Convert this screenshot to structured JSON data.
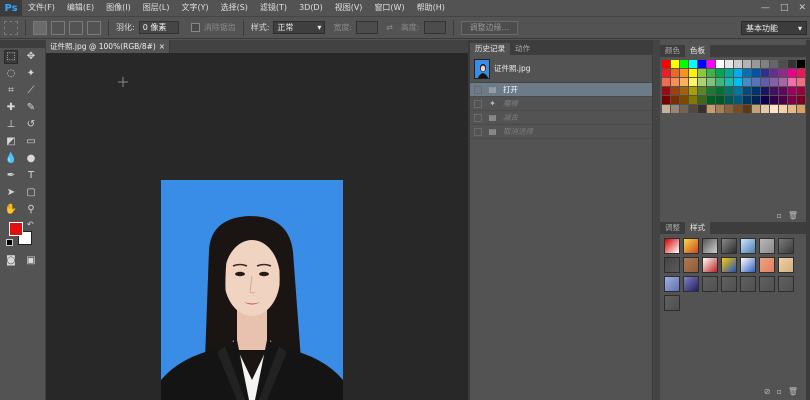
{
  "app": {
    "logo": "Ps"
  },
  "menubar": {
    "items": [
      "文件(F)",
      "编辑(E)",
      "图像(I)",
      "图层(L)",
      "文字(Y)",
      "选择(S)",
      "滤镜(T)",
      "3D(D)",
      "视图(V)",
      "窗口(W)",
      "帮助(H)"
    ],
    "window_controls": [
      "—",
      "□",
      "✕"
    ]
  },
  "options": {
    "feather_label": "羽化:",
    "feather_value": "0 像素",
    "antialias_label": "消除锯齿",
    "style_label": "样式:",
    "style_value": "正常",
    "width_label": "宽度:",
    "height_label": "高度:",
    "refine_edge": "调整边缘...",
    "workspace": "基本功能"
  },
  "document": {
    "tab_title": "证件照.jpg @ 100%(RGB/8#)",
    "tab_close": "×"
  },
  "history": {
    "tabs": [
      "历史记录",
      "动作"
    ],
    "snapshot_name": "证件照.jpg",
    "steps": [
      {
        "label": "打开",
        "state": "active"
      },
      {
        "label": "魔棒",
        "state": "dim"
      },
      {
        "label": "减去",
        "state": "dim"
      },
      {
        "label": "取消选择",
        "state": "dim"
      }
    ]
  },
  "swatches": {
    "tabs": [
      "颜色",
      "色板"
    ],
    "colors": [
      "#ff0000",
      "#ffff00",
      "#00ff00",
      "#00ffff",
      "#0000ff",
      "#ff00ff",
      "#ffffff",
      "#e6e6e6",
      "#cccccc",
      "#b3b3b3",
      "#999999",
      "#808080",
      "#666666",
      "#4d4d4d",
      "#333333",
      "#000000",
      "#ee1c24",
      "#f26522",
      "#f7941d",
      "#fff200",
      "#8dc63f",
      "#39b54a",
      "#00a651",
      "#00a99d",
      "#00aeef",
      "#0072bc",
      "#0054a6",
      "#2e3192",
      "#662d91",
      "#92278f",
      "#ec008c",
      "#ed145b",
      "#f26c4f",
      "#f68e56",
      "#fbaf5d",
      "#fff568",
      "#acd373",
      "#7cc576",
      "#3bb878",
      "#1abbb4",
      "#00bff3",
      "#438ccb",
      "#5574b9",
      "#605ca8",
      "#8560a8",
      "#a864a8",
      "#f06eaa",
      "#f26d7d",
      "#9e0b0f",
      "#a0410d",
      "#a36209",
      "#aba000",
      "#598527",
      "#1a7b30",
      "#007236",
      "#00746b",
      "#0076a3",
      "#004b80",
      "#003471",
      "#1b1464",
      "#440e62",
      "#630460",
      "#9e005d",
      "#9e0039",
      "#790000",
      "#7b2e00",
      "#7d4900",
      "#827b00",
      "#406618",
      "#005e20",
      "#005826",
      "#005952",
      "#005b7f",
      "#003663",
      "#002157",
      "#0d004c",
      "#32004b",
      "#4b0049",
      "#7b0046",
      "#7a0026",
      "#c7b299",
      "#998675",
      "#736357",
      "#534741",
      "#37302a",
      "#c69c6d",
      "#a67c52",
      "#8c6239",
      "#754c24",
      "#603913",
      "#c2a378",
      "#e6c9a8",
      "#ffe4c7",
      "#f5d0a9",
      "#e8b88a",
      "#d9a066"
    ]
  },
  "styles": {
    "tabs": [
      "调整",
      "样式"
    ],
    "items": [
      {
        "bg": "#ffffff",
        "fg": "#d40000",
        "icon": "none-style-icon"
      },
      {
        "bg": "#c84a1e",
        "fg": "#ffd54a",
        "icon": "star-style-icon"
      },
      {
        "bg": "#cfcfcf",
        "fg": "#555555",
        "icon": "frame-style-icon"
      },
      {
        "bg": "#2c2c2c",
        "fg": "#888888",
        "icon": "dark-bevel-icon"
      },
      {
        "bg": "#4a7fb0",
        "fg": "#cfe4ff",
        "icon": "blue-glass-icon"
      },
      {
        "bg": "#8a8a8a",
        "fg": "#b8b8b8",
        "icon": "gray-bevel-icon"
      },
      {
        "bg": "#3a3a3a",
        "fg": "#7a7a7a",
        "icon": "dark-box-icon"
      },
      {
        "bg": "#5a5a5a",
        "fg": "#444444",
        "icon": "gray-box-icon"
      },
      {
        "bg": "#8a5a3a",
        "fg": "#b07a50",
        "icon": "wood-icon"
      },
      {
        "bg": "#c02020",
        "fg": "#ffffff",
        "icon": "red-chrome-icon"
      },
      {
        "bg": "#2050c0",
        "fg": "#ffcc00",
        "icon": "rainbow-icon"
      },
      {
        "bg": "#3060c0",
        "fg": "#ffffff",
        "icon": "blue-chrome-icon"
      },
      {
        "bg": "#e08060",
        "fg": "#f0a080",
        "icon": "orange-grad-icon"
      },
      {
        "bg": "#d0b080",
        "fg": "#f0d0a0",
        "icon": "sand-icon"
      },
      {
        "bg": "#6070b0",
        "fg": "#a0b0e0",
        "icon": "purple-sky-icon"
      },
      {
        "bg": "#202060",
        "fg": "#8080c0",
        "icon": "night-icon"
      },
      {
        "bg": "#505050",
        "fg": "#606060",
        "icon": "empty-1-icon"
      },
      {
        "bg": "#505050",
        "fg": "#606060",
        "icon": "empty-2-icon"
      },
      {
        "bg": "#505050",
        "fg": "#606060",
        "icon": "empty-3-icon"
      },
      {
        "bg": "#505050",
        "fg": "#606060",
        "icon": "empty-4-icon"
      },
      {
        "bg": "#505050",
        "fg": "#606060",
        "icon": "empty-5-icon"
      },
      {
        "bg": "#505050",
        "fg": "#606060",
        "icon": "empty-6-icon"
      }
    ]
  },
  "colors": {
    "foreground": "#e01010",
    "background": "#ffffff",
    "canvas_bg": "#3a8de6"
  }
}
